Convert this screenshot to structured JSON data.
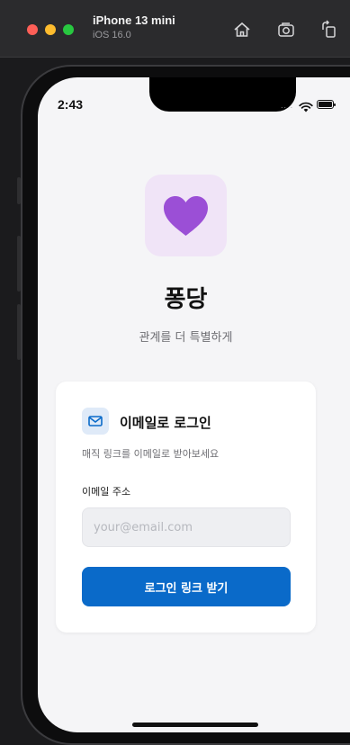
{
  "simulator": {
    "device_name": "iPhone 13 mini",
    "os_version": "iOS 16.0",
    "home_icon": "home-icon",
    "screenshot_icon": "camera-icon",
    "rotate_icon": "rotate-icon"
  },
  "status_bar": {
    "time": "2:43",
    "signal": "....",
    "wifi_icon": "wifi-icon",
    "battery_icon": "battery-icon"
  },
  "app": {
    "logo_icon": "heart-icon",
    "logo_color": "#9b4fd6",
    "logo_bg": "#f0e4f7",
    "title": "퐁당",
    "tagline": "관계를 더 특별하게"
  },
  "login_card": {
    "icon": "mail-icon",
    "title": "이메일로 로그인",
    "subtitle": "매직 링크를 이메일로 받아보세요",
    "email_label": "이메일 주소",
    "email_value": "",
    "email_placeholder": "your@email.com",
    "submit_label": "로그인 링크 받기",
    "accent_color": "#0a6ac9"
  }
}
